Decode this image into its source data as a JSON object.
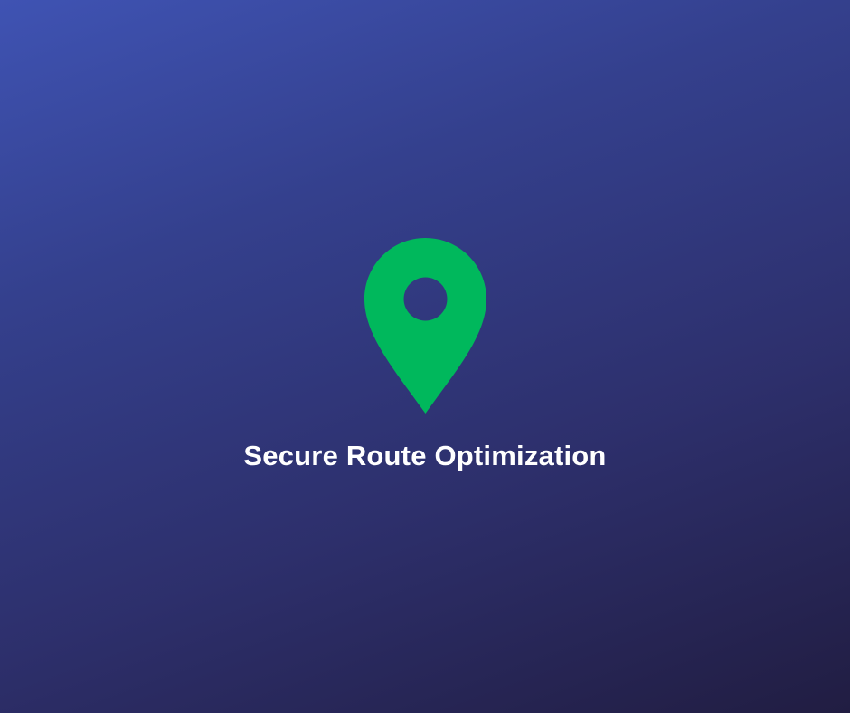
{
  "headline": "Secure Route Optimization",
  "icon": "location-pin-icon",
  "colors": {
    "pin": "#00b85c",
    "text": "#ffffff",
    "background_top": "#3f53b3",
    "background_bottom": "#211d42"
  }
}
